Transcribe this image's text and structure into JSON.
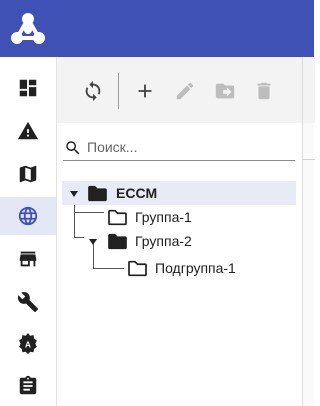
{
  "header": {
    "logo_icon": "hub-logo-icon",
    "background": "#3f51b5"
  },
  "sidebar": {
    "items": [
      {
        "name": "dashboard",
        "icon": "dashboard-icon"
      },
      {
        "name": "alarms",
        "icon": "warning-icon"
      },
      {
        "name": "map",
        "icon": "map-icon"
      },
      {
        "name": "network",
        "icon": "globe-icon",
        "active": true
      },
      {
        "name": "store",
        "icon": "store-icon"
      },
      {
        "name": "tools",
        "icon": "wrench-icon"
      },
      {
        "name": "auto",
        "icon": "auto-badge-icon"
      },
      {
        "name": "reports",
        "icon": "clipboard-icon"
      }
    ]
  },
  "toolbar": {
    "buttons": [
      {
        "name": "refresh",
        "icon": "sync-icon",
        "enabled": true
      },
      {
        "name": "add",
        "icon": "plus-icon",
        "enabled": true
      },
      {
        "name": "edit",
        "icon": "pencil-icon",
        "enabled": false
      },
      {
        "name": "move",
        "icon": "folder-move-icon",
        "enabled": false
      },
      {
        "name": "delete",
        "icon": "trash-icon",
        "enabled": false
      }
    ]
  },
  "search": {
    "placeholder": "Поиск...",
    "value": ""
  },
  "tree": {
    "root": {
      "label": "ECCM",
      "expanded": true,
      "selected": true
    },
    "group1": {
      "label": "Группа-1"
    },
    "group2": {
      "label": "Группа-2",
      "expanded": true
    },
    "subgroup1": {
      "label": "Подгруппа-1"
    }
  },
  "colors": {
    "accent": "#3f51b5",
    "selected_row": "#e8eaf6",
    "icon": "#212121",
    "disabled_icon": "#bdbdbd"
  }
}
